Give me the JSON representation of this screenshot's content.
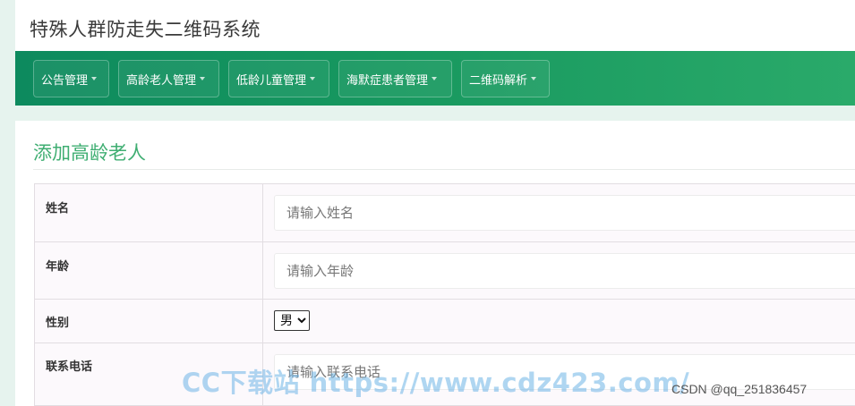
{
  "app": {
    "title": "特殊人群防走失二维码系统"
  },
  "nav": {
    "items": [
      {
        "label": "公告管理"
      },
      {
        "label": "高龄老人管理"
      },
      {
        "label": "低龄儿童管理"
      },
      {
        "label": "海默症患者管理"
      },
      {
        "label": "二维码解析"
      }
    ]
  },
  "panel": {
    "title": "添加高龄老人",
    "fields": [
      {
        "label": "姓名",
        "placeholder": "请输入姓名"
      },
      {
        "label": "年龄",
        "placeholder": "请输入年龄"
      },
      {
        "label": "性别",
        "selected": "男"
      },
      {
        "label": "联系电话",
        "placeholder": "请输入联系电话"
      }
    ]
  },
  "overlay": {
    "watermark": "CC下载站 https://www.cdz423.com/",
    "credit": "CSDN @qq_251836457"
  },
  "colors": {
    "nav_gradient_start": "#0d8a5e",
    "nav_gradient_end": "#2aaa6a",
    "title_green": "#3fae72",
    "page_background": "#e6f3ee"
  }
}
